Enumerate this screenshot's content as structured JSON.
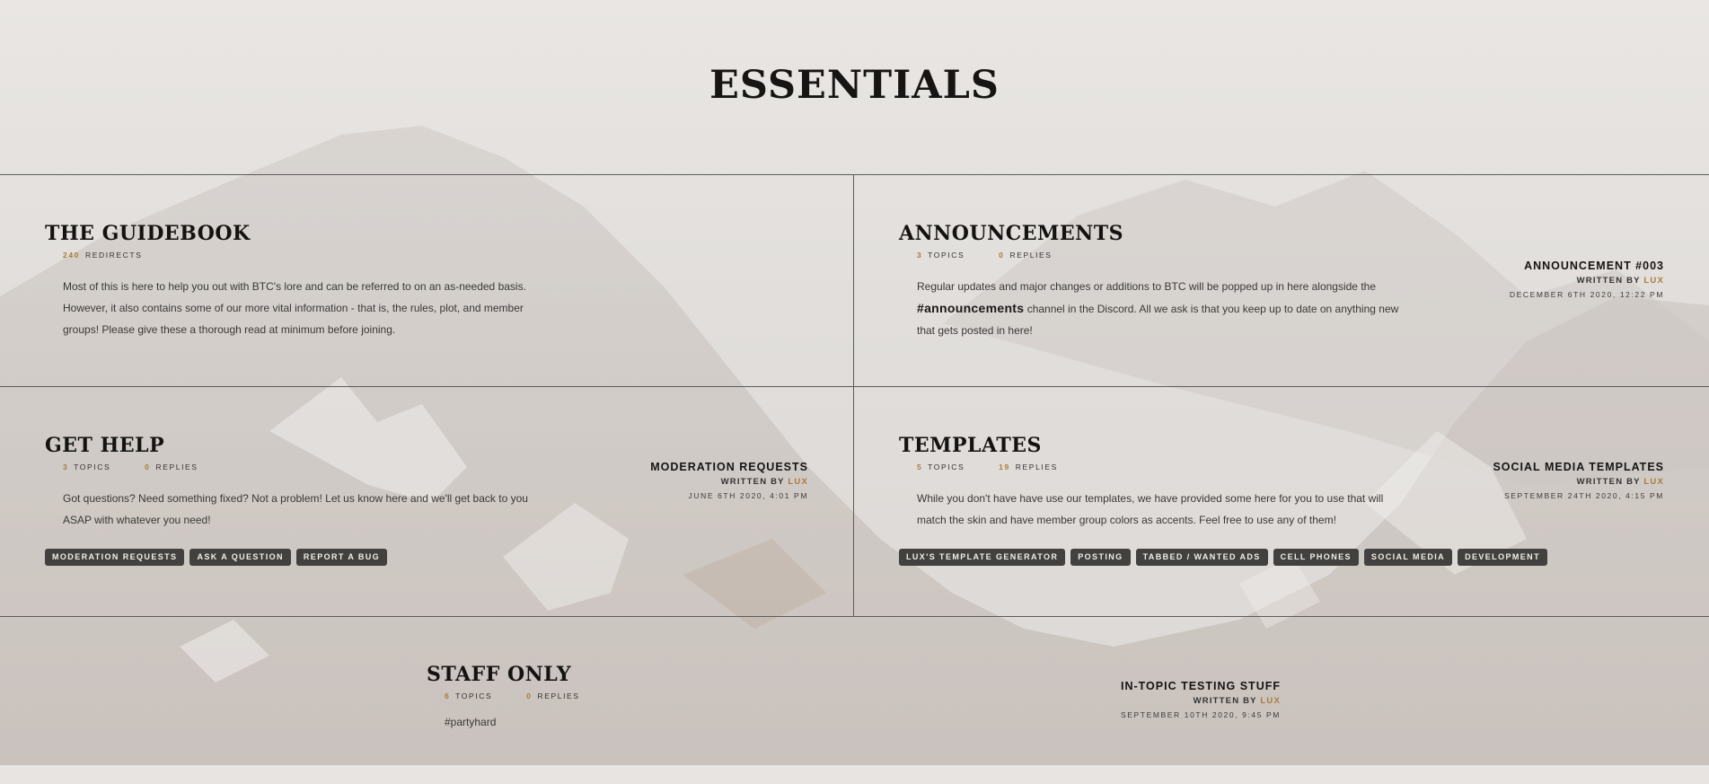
{
  "page": {
    "heading": "ESSENTIALS"
  },
  "forums": {
    "guidebook": {
      "title": "THE GUIDEBOOK",
      "stat1_num": "240",
      "stat1_label": "REDIRECTS",
      "desc": "Most of this is here to help you out with BTC's lore and can be referred to on an as-needed basis. However, it also contains some of our more vital information - that is, the rules, plot, and member groups! Please give these a thorough read at minimum before joining."
    },
    "announcements": {
      "title": "ANNOUNCEMENTS",
      "stat1_num": "3",
      "stat1_label": "TOPICS",
      "stat2_num": "0",
      "stat2_label": "REPLIES",
      "desc_pre": "Regular updates and major changes or additions to BTC will be popped up in here alongside the",
      "desc_bold": "#announcements",
      "desc_post": "channel in the Discord. All we ask is that you keep up to date on anything new that gets posted in here!",
      "last_title": "ANNOUNCEMENT #003",
      "written_by": "WRITTEN BY",
      "author": "LUX",
      "date": "DECEMBER 6TH 2020, 12:22 PM"
    },
    "get_help": {
      "title": "GET HELP",
      "stat1_num": "3",
      "stat1_label": "TOPICS",
      "stat2_num": "0",
      "stat2_label": "REPLIES",
      "desc": "Got questions? Need something fixed? Not a problem! Let us know here and we'll get back to you ASAP with whatever you need!",
      "last_title": "MODERATION REQUESTS",
      "written_by": "WRITTEN BY",
      "author": "LUX",
      "date": "JUNE 6TH 2020, 4:01 PM",
      "subforums": [
        "MODERATION REQUESTS",
        "ASK A QUESTION",
        "REPORT A BUG"
      ]
    },
    "templates": {
      "title": "TEMPLATES",
      "stat1_num": "5",
      "stat1_label": "TOPICS",
      "stat2_num": "19",
      "stat2_label": "REPLIES",
      "desc": "While you don't have have use our templates, we have provided some here for you to use that will match the skin and have member group colors as accents. Feel free to use any of them!",
      "last_title": "SOCIAL MEDIA TEMPLATES",
      "written_by": "WRITTEN BY",
      "author": "LUX",
      "date": "SEPTEMBER 24TH 2020, 4:15 PM",
      "subforums": [
        "LUX'S TEMPLATE GENERATOR",
        "POSTING",
        "TABBED / WANTED ADS",
        "CELL PHONES",
        "SOCIAL MEDIA",
        "DEVELOPMENT"
      ]
    },
    "staff_only": {
      "title": "STAFF ONLY",
      "stat1_num": "6",
      "stat1_label": "TOPICS",
      "stat2_num": "0",
      "stat2_label": "REPLIES",
      "desc": "#partyhard",
      "last_title": "IN-TOPIC TESTING STUFF",
      "written_by": "WRITTEN BY",
      "author": "LUX",
      "date": "SEPTEMBER 10TH 2020, 9:45 PM"
    }
  },
  "colors": {
    "accent": "#a97c3d",
    "tag_bg": "#43413f",
    "line": "#5e5c5a"
  }
}
